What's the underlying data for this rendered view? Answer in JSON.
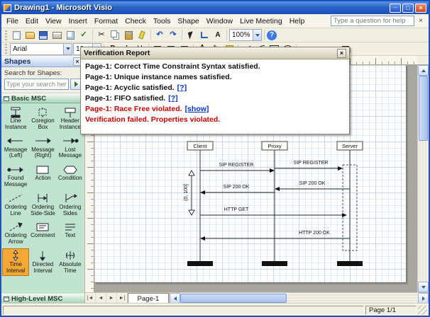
{
  "window": {
    "title": "Drawing1 - Microsoft Visio"
  },
  "menu": {
    "items": [
      "File",
      "Edit",
      "View",
      "Insert",
      "Format",
      "Check",
      "Tools",
      "Shape",
      "Window",
      "Live Meeting",
      "Help"
    ],
    "help_placeholder": "Type a question for help"
  },
  "toolbar": {
    "font": "Arial",
    "font_size": "12pt",
    "zoom": "100%"
  },
  "shapes": {
    "title": "Shapes",
    "search_label": "Search for Shapes:",
    "search_placeholder": "Type your search here",
    "section_basic": "Basic MSC",
    "section_high": "High-Level MSC",
    "items": [
      "Line Instance",
      "Coregion Box",
      "Header Instance",
      "Message (Left)",
      "Message (Right)",
      "Lost Message",
      "Found Message",
      "Action",
      "Condition",
      "Ordering Line",
      "Ordering Side-Side",
      "Ordering Sides",
      "Ordering Arrow",
      "Comment",
      "Text",
      "Time Interval",
      "Directed Interval",
      "Absolute Time"
    ]
  },
  "report": {
    "title": "Verification Report",
    "lines": [
      {
        "text": "Page-1: Correct Time Constraint Syntax satisfied.",
        "link": ""
      },
      {
        "text": "Page-1: Unique instance names satisfied.",
        "link": ""
      },
      {
        "text": "Page-1: Acyclic satisfied.",
        "link": "[?]"
      },
      {
        "text": "Page-1: FIFO satisfied.",
        "link": "[?]"
      },
      {
        "text": "Page-1: Race Free violated.",
        "link": "[show]"
      },
      {
        "text": "Verification failed. Properties violated.",
        "link": ""
      }
    ]
  },
  "diagram": {
    "lifelines": [
      "Client",
      "Proxy",
      "Server"
    ],
    "messages": [
      "SIP REGISTER",
      "SIP REGISTER",
      "SIP 200 OK",
      "SIP 200 OK",
      "HTTP GET",
      "HTTP 200 OK"
    ],
    "time_interval": "(0, 100]"
  },
  "tabs": {
    "page": "Page-1"
  },
  "status": {
    "page_indicator": "Page 1/1"
  },
  "colors": {
    "error": "#cc0000",
    "link": "#0033cc",
    "selection": "#f5a833"
  }
}
